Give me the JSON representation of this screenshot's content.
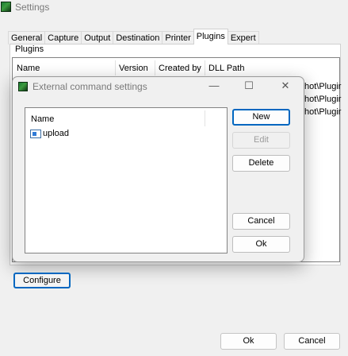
{
  "window": {
    "title": "Settings",
    "icon": "greenshot-app-icon"
  },
  "tabs": [
    {
      "label": "General",
      "active": false
    },
    {
      "label": "Capture",
      "active": false
    },
    {
      "label": "Output",
      "active": false
    },
    {
      "label": "Destination",
      "active": false
    },
    {
      "label": "Printer",
      "active": false
    },
    {
      "label": "Plugins",
      "active": true
    },
    {
      "label": "Expert",
      "active": false
    }
  ],
  "plugins": {
    "group_label": "Plugins",
    "columns": [
      "Name",
      "Version",
      "Created by",
      "DLL Path"
    ],
    "rows": [
      {
        "dll_path_visible": "hot\\Plugir"
      },
      {
        "dll_path_visible": "hot\\Plugir"
      },
      {
        "dll_path_visible": "hot\\Plugir"
      }
    ],
    "configure_label": "Configure"
  },
  "dialog": {
    "title": "External command settings",
    "icon": "greenshot-app-icon",
    "controls": {
      "minimize": "—",
      "maximize": "☐",
      "close": "✕"
    },
    "list_header": "Name",
    "items": [
      {
        "label": "upload",
        "icon": "command-icon"
      }
    ],
    "buttons": {
      "new": "New",
      "edit": "Edit",
      "delete": "Delete",
      "cancel": "Cancel",
      "ok": "Ok"
    },
    "edit_enabled": false
  },
  "footer": {
    "ok": "Ok",
    "cancel": "Cancel"
  },
  "colors": {
    "accent": "#0067c0",
    "window_bg": "#f0f0f0",
    "title_text": "#7a7a7a",
    "disabled_text": "#9c9c9c"
  }
}
